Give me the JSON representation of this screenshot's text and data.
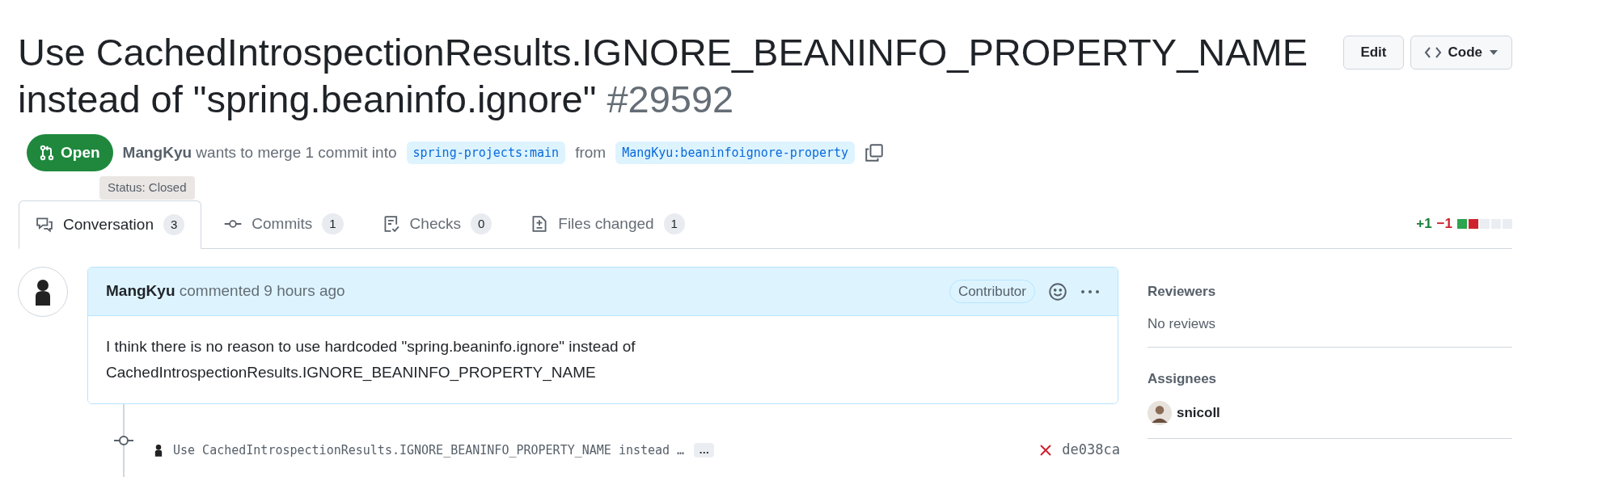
{
  "title": {
    "text": "Use CachedIntrospectionResults.IGNORE_BEANINFO_PROPERTY_NAME instead of \"spring.beaninfo.ignore\"",
    "number": "#29592"
  },
  "header_buttons": [
    {
      "kind": "plain",
      "label": "Edit"
    },
    {
      "kind": "code",
      "label": "Code"
    }
  ],
  "state_badge": {
    "label": "Open"
  },
  "summary": {
    "author": "MangKyu",
    "text": "wants to merge 1 commit into",
    "base": "spring-projects:main",
    "from": "from",
    "head": "MangKyu:beaninfoignore-property"
  },
  "tooltip": "Status: Closed",
  "tabs": [
    {
      "kind": "conversation",
      "label": "Conversation",
      "count": "3",
      "selected": true
    },
    {
      "kind": "commits",
      "label": "Commits",
      "count": "1",
      "selected": false
    },
    {
      "kind": "checks",
      "label": "Checks",
      "count": "0",
      "selected": false
    },
    {
      "kind": "files",
      "label": "Files changed",
      "count": "1",
      "selected": false
    }
  ],
  "diffstat": {
    "added": "+1",
    "removed": "−1",
    "blocks": [
      {
        "color": "#2da44e"
      },
      {
        "color": "#cf222e"
      },
      {
        "color": "#eaeef2"
      },
      {
        "color": "#eaeef2"
      },
      {
        "color": "#eaeef2"
      }
    ]
  },
  "comment": {
    "author": "MangKyu",
    "meta": "commented 9 hours ago",
    "badge": "Contributor",
    "body": [
      "I think there is no reason to use hardcoded \"spring.beaninfo.ignore\" instead of",
      "CachedIntrospectionResults.IGNORE_BEANINFO_PROPERTY_NAME"
    ]
  },
  "commit": {
    "message": "Use CachedIntrospectionResults.IGNORE_BEANINFO_PROPERTY_NAME instead …",
    "more": "…",
    "failed": true,
    "sha": "de038ca"
  },
  "sidebar": [
    {
      "heading": "Reviewers",
      "kind": "text",
      "value": "No reviews"
    },
    {
      "heading": "Assignees",
      "kind": "user",
      "value": "snicoll"
    }
  ]
}
